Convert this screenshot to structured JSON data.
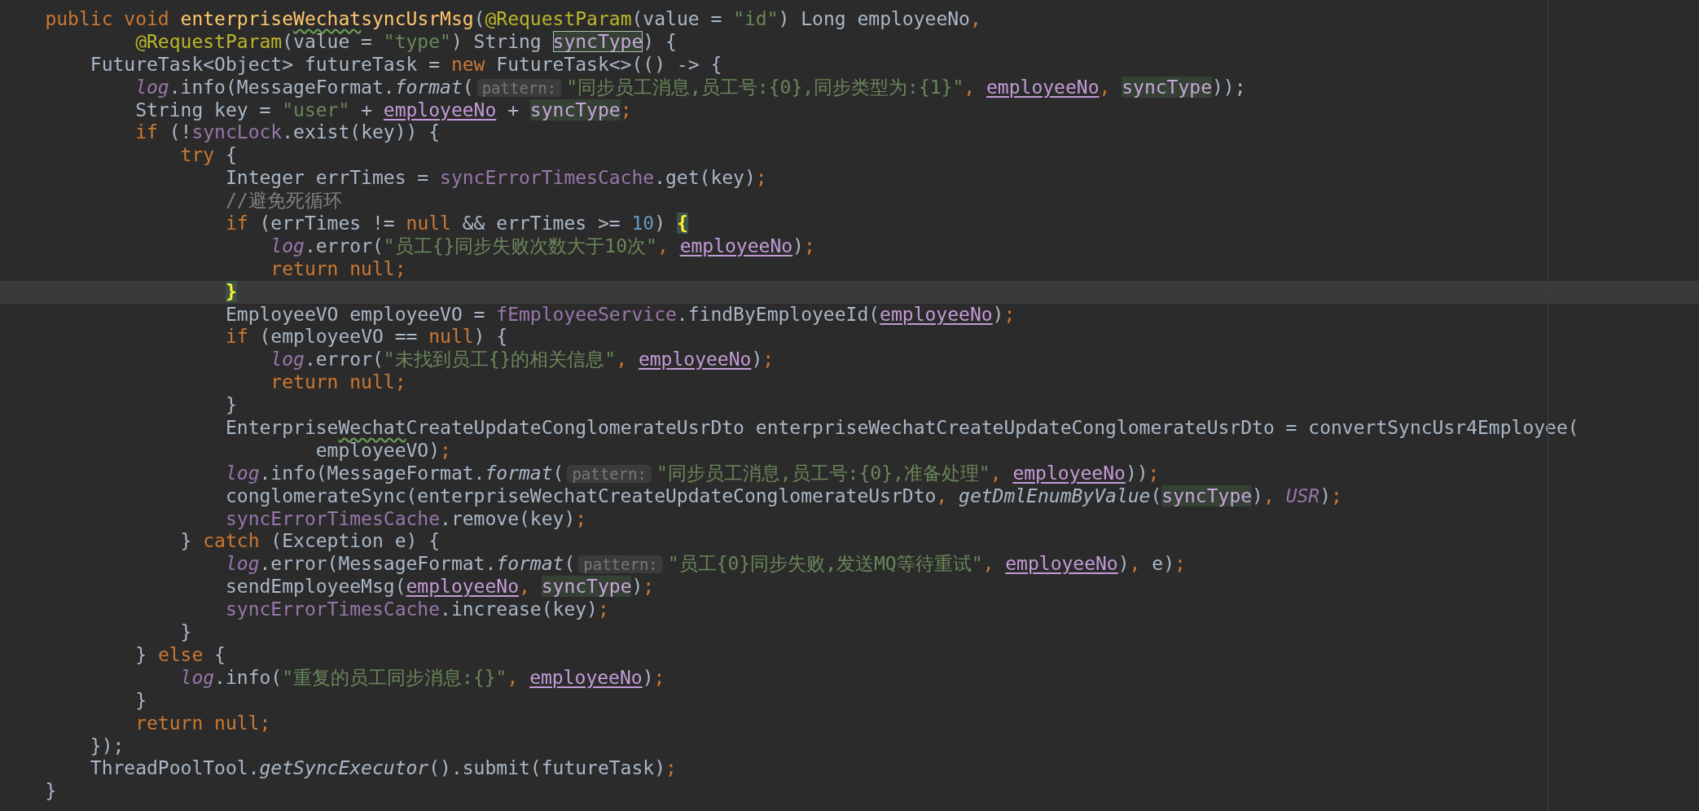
{
  "editor": {
    "lines": [
      {
        "current": false,
        "tokens": [
          {
            "kind": "keyword",
            "text": "    public void "
          },
          {
            "kind": "method-decl",
            "text": "enterprise"
          },
          {
            "kind": "method-decl-typo",
            "text": "Wechat"
          },
          {
            "kind": "method-decl",
            "text": "syncUsrMsg"
          },
          {
            "kind": "plain",
            "text": "("
          },
          {
            "kind": "annotation",
            "text": "@RequestParam"
          },
          {
            "kind": "plain",
            "text": "(value = "
          },
          {
            "kind": "string",
            "text": "\"id\""
          },
          {
            "kind": "plain",
            "text": ") Long employeeNo"
          },
          {
            "kind": "keyword",
            "text": ","
          }
        ]
      },
      {
        "current": false,
        "tokens": [
          {
            "kind": "annotation",
            "text": "            @RequestParam"
          },
          {
            "kind": "plain",
            "text": "(value = "
          },
          {
            "kind": "string",
            "text": "\"type\""
          },
          {
            "kind": "plain",
            "text": ") String "
          },
          {
            "kind": "usage-decl",
            "text": "syncType"
          },
          {
            "kind": "plain",
            "text": ") {"
          }
        ]
      },
      {
        "current": false,
        "tokens": [
          {
            "kind": "plain",
            "text": "        FutureTask<Object> futureTask = "
          },
          {
            "kind": "keyword",
            "text": "new"
          },
          {
            "kind": "plain",
            "text": " FutureTask<>(() -> {"
          }
        ]
      },
      {
        "current": false,
        "tokens": [
          {
            "kind": "static-field",
            "text": "            log"
          },
          {
            "kind": "plain",
            "text": ".info(MessageFormat."
          },
          {
            "kind": "static-method",
            "text": "format"
          },
          {
            "kind": "plain",
            "text": "("
          },
          {
            "kind": "hint",
            "text": "pattern:"
          },
          {
            "kind": "string",
            "text": "\"同步员工消息,员工号:{0},同步类型为:{1}\""
          },
          {
            "kind": "keyword",
            "text": ", "
          },
          {
            "kind": "param",
            "text": "employeeNo"
          },
          {
            "kind": "keyword",
            "text": ", "
          },
          {
            "kind": "usage",
            "text": "syncType"
          },
          {
            "kind": "plain",
            "text": "));"
          }
        ]
      },
      {
        "current": false,
        "tokens": [
          {
            "kind": "plain",
            "text": "            String key = "
          },
          {
            "kind": "string",
            "text": "\"user\""
          },
          {
            "kind": "plain",
            "text": " + "
          },
          {
            "kind": "param",
            "text": "employeeNo"
          },
          {
            "kind": "plain",
            "text": " + "
          },
          {
            "kind": "usage",
            "text": "syncType"
          },
          {
            "kind": "keyword",
            "text": ";"
          }
        ]
      },
      {
        "current": false,
        "tokens": [
          {
            "kind": "keyword",
            "text": "            if"
          },
          {
            "kind": "plain",
            "text": " (!"
          },
          {
            "kind": "field",
            "text": "syncLock"
          },
          {
            "kind": "plain",
            "text": ".exist(key)) {"
          }
        ]
      },
      {
        "current": false,
        "tokens": [
          {
            "kind": "keyword",
            "text": "                try"
          },
          {
            "kind": "plain",
            "text": " {"
          }
        ]
      },
      {
        "current": false,
        "tokens": [
          {
            "kind": "plain",
            "text": "                    Integer errTimes = "
          },
          {
            "kind": "field",
            "text": "syncErrorTimesCache"
          },
          {
            "kind": "plain",
            "text": ".get(key)"
          },
          {
            "kind": "keyword",
            "text": ";"
          }
        ]
      },
      {
        "current": false,
        "tokens": [
          {
            "kind": "comment",
            "text": "                    //避免死循环"
          }
        ]
      },
      {
        "current": false,
        "tokens": [
          {
            "kind": "keyword",
            "text": "                    if"
          },
          {
            "kind": "plain",
            "text": " (errTimes != "
          },
          {
            "kind": "keyword",
            "text": "null"
          },
          {
            "kind": "plain",
            "text": " && errTimes >= "
          },
          {
            "kind": "number",
            "text": "10"
          },
          {
            "kind": "plain",
            "text": ") "
          },
          {
            "kind": "brace-match",
            "text": "{"
          }
        ]
      },
      {
        "current": false,
        "tokens": [
          {
            "kind": "static-field",
            "text": "                        log"
          },
          {
            "kind": "plain",
            "text": ".error("
          },
          {
            "kind": "string",
            "text": "\"员工{}同步失败次数大于10次\""
          },
          {
            "kind": "keyword",
            "text": ", "
          },
          {
            "kind": "param",
            "text": "employeeNo"
          },
          {
            "kind": "plain",
            "text": ")"
          },
          {
            "kind": "keyword",
            "text": ";"
          }
        ]
      },
      {
        "current": false,
        "tokens": [
          {
            "kind": "keyword",
            "text": "                        return null;"
          }
        ]
      },
      {
        "current": true,
        "tokens": [
          {
            "kind": "brace-match",
            "text": "                    }"
          }
        ]
      },
      {
        "current": false,
        "tokens": [
          {
            "kind": "plain",
            "text": "                    EmployeeVO employeeVO = "
          },
          {
            "kind": "field",
            "text": "fEmployeeService"
          },
          {
            "kind": "plain",
            "text": ".findByEmployeeId("
          },
          {
            "kind": "param",
            "text": "employeeNo"
          },
          {
            "kind": "plain",
            "text": ")"
          },
          {
            "kind": "keyword",
            "text": ";"
          }
        ]
      },
      {
        "current": false,
        "tokens": [
          {
            "kind": "keyword",
            "text": "                    if"
          },
          {
            "kind": "plain",
            "text": " (employeeVO == "
          },
          {
            "kind": "keyword",
            "text": "null"
          },
          {
            "kind": "plain",
            "text": ") {"
          }
        ]
      },
      {
        "current": false,
        "tokens": [
          {
            "kind": "static-field",
            "text": "                        log"
          },
          {
            "kind": "plain",
            "text": ".error("
          },
          {
            "kind": "string",
            "text": "\"未找到员工{}的相关信息\""
          },
          {
            "kind": "keyword",
            "text": ", "
          },
          {
            "kind": "param",
            "text": "employeeNo"
          },
          {
            "kind": "plain",
            "text": ")"
          },
          {
            "kind": "keyword",
            "text": ";"
          }
        ]
      },
      {
        "current": false,
        "tokens": [
          {
            "kind": "keyword",
            "text": "                        return null;"
          }
        ]
      },
      {
        "current": false,
        "tokens": [
          {
            "kind": "plain",
            "text": "                    }"
          }
        ]
      },
      {
        "current": false,
        "tokens": [
          {
            "kind": "plain",
            "text": "                    Enterprise"
          },
          {
            "kind": "typo",
            "text": "Wechat"
          },
          {
            "kind": "plain",
            "text": "CreateUpdateConglomerateUsrDto enterpriseWechatCreateUpdateConglomerateUsrDto = convertSyncUsr4Employee("
          }
        ]
      },
      {
        "current": false,
        "tokens": [
          {
            "kind": "plain",
            "text": "                            employeeVO)"
          },
          {
            "kind": "keyword",
            "text": ";"
          }
        ]
      },
      {
        "current": false,
        "tokens": [
          {
            "kind": "static-field",
            "text": "                    log"
          },
          {
            "kind": "plain",
            "text": ".info(MessageFormat."
          },
          {
            "kind": "static-method",
            "text": "format"
          },
          {
            "kind": "plain",
            "text": "("
          },
          {
            "kind": "hint",
            "text": "pattern:"
          },
          {
            "kind": "string",
            "text": "\"同步员工消息,员工号:{0},准备处理\""
          },
          {
            "kind": "keyword",
            "text": ", "
          },
          {
            "kind": "param",
            "text": "employeeNo"
          },
          {
            "kind": "plain",
            "text": "))"
          },
          {
            "kind": "keyword",
            "text": ";"
          }
        ]
      },
      {
        "current": false,
        "tokens": [
          {
            "kind": "plain",
            "text": "                    conglomerateSync(enterpriseWechatCreateUpdateConglomerateUsrDto"
          },
          {
            "kind": "keyword",
            "text": ", "
          },
          {
            "kind": "static-method",
            "text": "getDmlEnumByValue"
          },
          {
            "kind": "plain",
            "text": "("
          },
          {
            "kind": "usage",
            "text": "syncType"
          },
          {
            "kind": "plain",
            "text": ")"
          },
          {
            "kind": "keyword",
            "text": ", "
          },
          {
            "kind": "static-field",
            "text": "USR"
          },
          {
            "kind": "plain",
            "text": ")"
          },
          {
            "kind": "keyword",
            "text": ";"
          }
        ]
      },
      {
        "current": false,
        "tokens": [
          {
            "kind": "field",
            "text": "                    syncErrorTimesCache"
          },
          {
            "kind": "plain",
            "text": ".remove(key)"
          },
          {
            "kind": "keyword",
            "text": ";"
          }
        ]
      },
      {
        "current": false,
        "tokens": [
          {
            "kind": "plain",
            "text": "                } "
          },
          {
            "kind": "keyword",
            "text": "catch"
          },
          {
            "kind": "plain",
            "text": " (Exception e) {"
          }
        ]
      },
      {
        "current": false,
        "tokens": [
          {
            "kind": "static-field",
            "text": "                    log"
          },
          {
            "kind": "plain",
            "text": ".error(MessageFormat."
          },
          {
            "kind": "static-method",
            "text": "format"
          },
          {
            "kind": "plain",
            "text": "("
          },
          {
            "kind": "hint",
            "text": "pattern:"
          },
          {
            "kind": "string",
            "text": "\"员工{0}同步失败,发送MQ等待重试\""
          },
          {
            "kind": "keyword",
            "text": ", "
          },
          {
            "kind": "param",
            "text": "employeeNo"
          },
          {
            "kind": "plain",
            "text": ")"
          },
          {
            "kind": "keyword",
            "text": ", "
          },
          {
            "kind": "plain",
            "text": "e)"
          },
          {
            "kind": "keyword",
            "text": ";"
          }
        ]
      },
      {
        "current": false,
        "tokens": [
          {
            "kind": "plain",
            "text": "                    sendEmployeeMsg("
          },
          {
            "kind": "param",
            "text": "employeeNo"
          },
          {
            "kind": "keyword",
            "text": ", "
          },
          {
            "kind": "usage",
            "text": "syncType"
          },
          {
            "kind": "plain",
            "text": ")"
          },
          {
            "kind": "keyword",
            "text": ";"
          }
        ]
      },
      {
        "current": false,
        "tokens": [
          {
            "kind": "field",
            "text": "                    syncErrorTimesCache"
          },
          {
            "kind": "plain",
            "text": ".increase(key)"
          },
          {
            "kind": "keyword",
            "text": ";"
          }
        ]
      },
      {
        "current": false,
        "tokens": [
          {
            "kind": "plain",
            "text": "                }"
          }
        ]
      },
      {
        "current": false,
        "tokens": [
          {
            "kind": "plain",
            "text": "            } "
          },
          {
            "kind": "keyword",
            "text": "else"
          },
          {
            "kind": "plain",
            "text": " {"
          }
        ]
      },
      {
        "current": false,
        "tokens": [
          {
            "kind": "static-field",
            "text": "                log"
          },
          {
            "kind": "plain",
            "text": ".info("
          },
          {
            "kind": "string",
            "text": "\"重复的员工同步消息:{}\""
          },
          {
            "kind": "keyword",
            "text": ", "
          },
          {
            "kind": "param",
            "text": "employeeNo"
          },
          {
            "kind": "plain",
            "text": ")"
          },
          {
            "kind": "keyword",
            "text": ";"
          }
        ]
      },
      {
        "current": false,
        "tokens": [
          {
            "kind": "plain",
            "text": "            }"
          }
        ]
      },
      {
        "current": false,
        "tokens": [
          {
            "kind": "keyword",
            "text": "            return null;"
          }
        ]
      },
      {
        "current": false,
        "tokens": [
          {
            "kind": "plain",
            "text": "        });"
          }
        ]
      },
      {
        "current": false,
        "tokens": [
          {
            "kind": "plain",
            "text": "        ThreadPoolTool."
          },
          {
            "kind": "static-method",
            "text": "getSyncExecutor"
          },
          {
            "kind": "plain",
            "text": "().submit(futureTask)"
          },
          {
            "kind": "keyword",
            "text": ";"
          }
        ]
      },
      {
        "current": false,
        "tokens": [
          {
            "kind": "plain",
            "text": "    }"
          }
        ]
      }
    ]
  }
}
